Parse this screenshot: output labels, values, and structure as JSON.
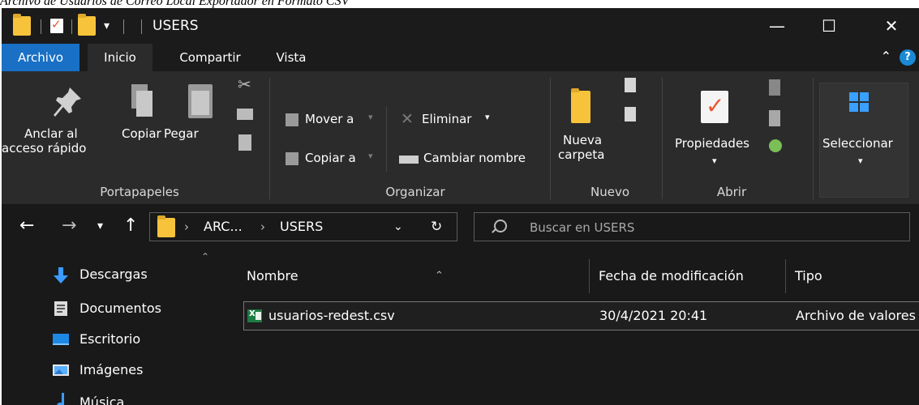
{
  "caption": "Archivo de Usuarios de Correo Local Exportador en Formato CSV",
  "window": {
    "title": "USERS",
    "controls": {
      "minimize": "—",
      "maximize": "☐",
      "close": "✕"
    }
  },
  "menu_tabs": [
    {
      "label": "Archivo"
    },
    {
      "label": "Inicio"
    },
    {
      "label": "Compartir"
    },
    {
      "label": "Vista"
    }
  ],
  "help_label": "?",
  "ribbon": {
    "portapapeles": {
      "group_label": "Portapapeles",
      "pin_line1": "Anclar al",
      "pin_line2": "acceso rápido",
      "copy": "Copiar",
      "paste": "Pegar"
    },
    "organizar": {
      "group_label": "Organizar",
      "move_to": "Mover a",
      "copy_to": "Copiar a",
      "delete": "Eliminar",
      "rename": "Cambiar nombre"
    },
    "nuevo": {
      "group_label": "Nuevo",
      "new_folder_line1": "Nueva",
      "new_folder_line2": "carpeta"
    },
    "abrir": {
      "group_label": "Abrir",
      "properties": "Propiedades"
    },
    "seleccionar": {
      "label": "Seleccionar"
    }
  },
  "address": {
    "crumbs": [
      "ARC...",
      "USERS"
    ]
  },
  "search": {
    "placeholder": "Buscar en USERS"
  },
  "nav_pane": [
    {
      "label": "Descargas",
      "icon": "download-icon",
      "color": "#3a9cff"
    },
    {
      "label": "Documentos",
      "icon": "document-icon",
      "color": "#d8d8d8"
    },
    {
      "label": "Escritorio",
      "icon": "desktop-icon",
      "color": "#1e88e5"
    },
    {
      "label": "Imágenes",
      "icon": "pictures-icon",
      "color": "#5ab0ff"
    },
    {
      "label": "Música",
      "icon": "music-icon",
      "color": "#3a9cff"
    }
  ],
  "file_list": {
    "columns": [
      "Nombre",
      "Fecha de modificación",
      "Tipo"
    ],
    "rows": [
      {
        "name": "usuarios-redest.csv",
        "modified": "30/4/2021 20:41",
        "type": "Archivo de valores separados por comas"
      }
    ]
  }
}
